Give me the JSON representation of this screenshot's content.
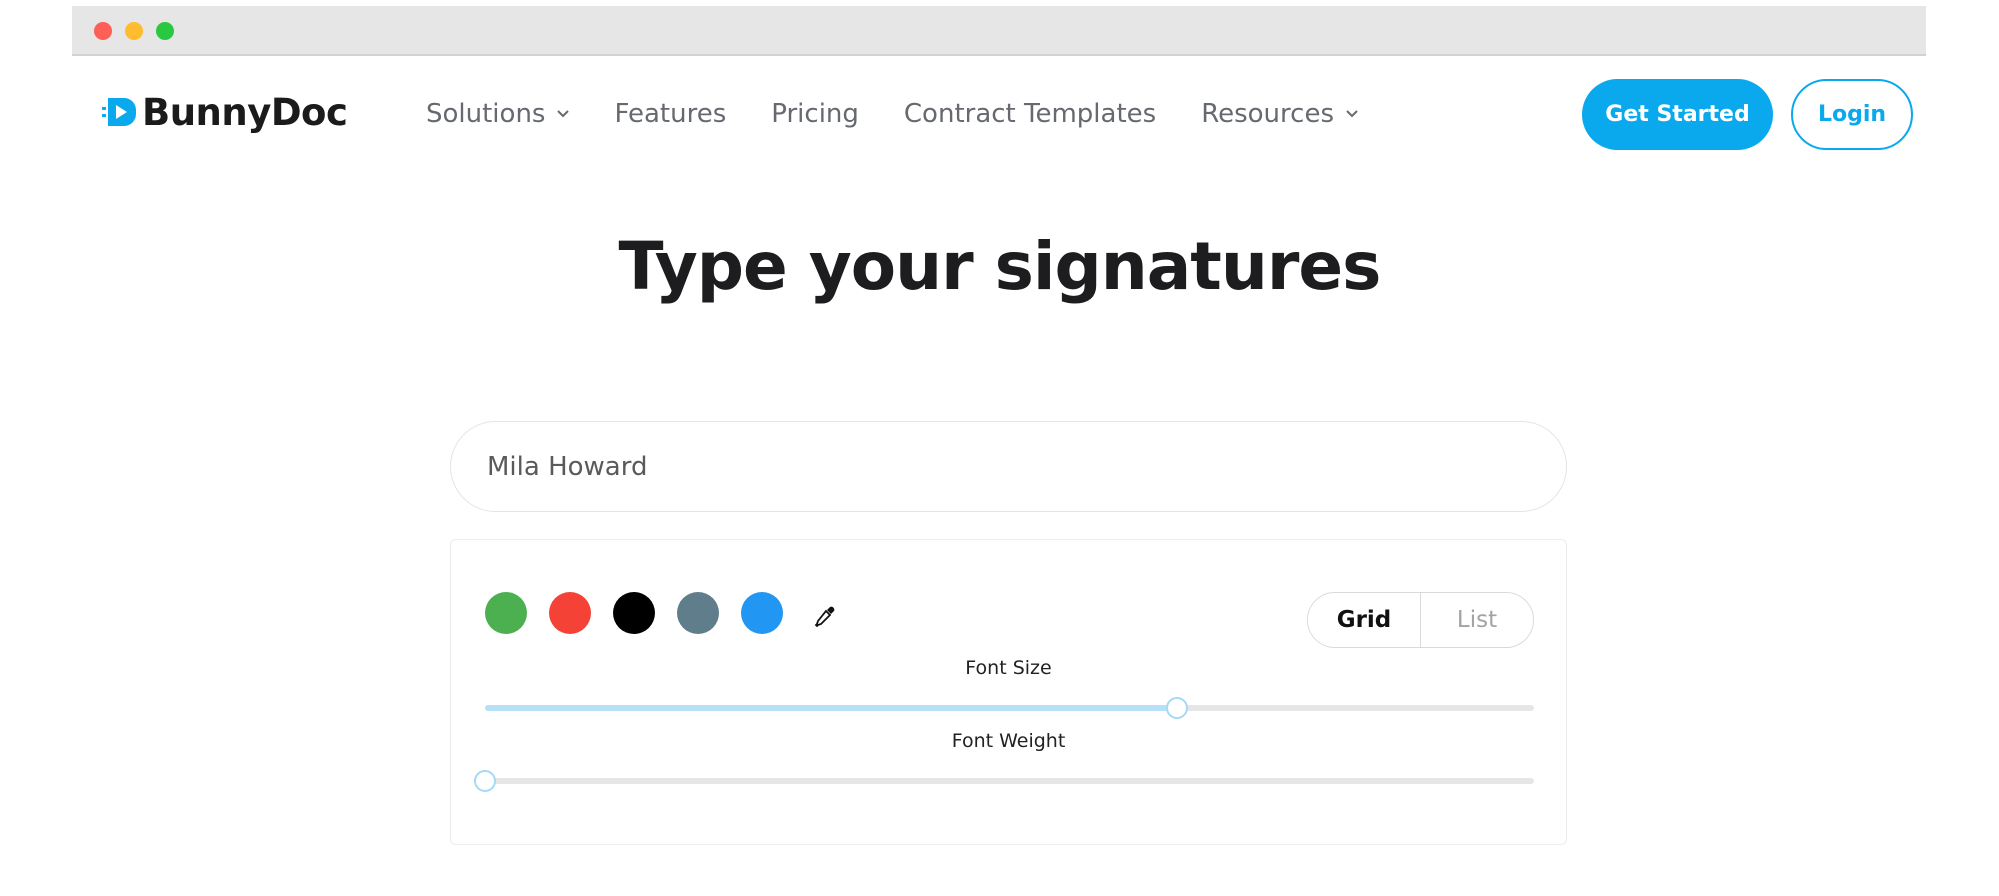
{
  "window": {},
  "brand": {
    "name": "BunnyDoc",
    "accent": "#0aa8ec"
  },
  "nav": {
    "items": [
      {
        "label": "Solutions",
        "has_dropdown": true
      },
      {
        "label": "Features",
        "has_dropdown": false
      },
      {
        "label": "Pricing",
        "has_dropdown": false
      },
      {
        "label": "Contract Templates",
        "has_dropdown": false
      },
      {
        "label": "Resources",
        "has_dropdown": true
      }
    ],
    "get_started": "Get Started",
    "login": "Login"
  },
  "main": {
    "title": "Type your signatures",
    "name_input": {
      "value": "Mila Howard"
    }
  },
  "options": {
    "colors": [
      "#4caf50",
      "#f44336",
      "#000000",
      "#607d8b",
      "#2196f3"
    ],
    "picker_icon": "eyedropper-icon",
    "view_toggle": {
      "grid": "Grid",
      "list": "List",
      "selected": "grid"
    },
    "font_size": {
      "label": "Font Size",
      "value_pct": 66
    },
    "font_weight": {
      "label": "Font Weight",
      "value_pct": 0
    }
  }
}
